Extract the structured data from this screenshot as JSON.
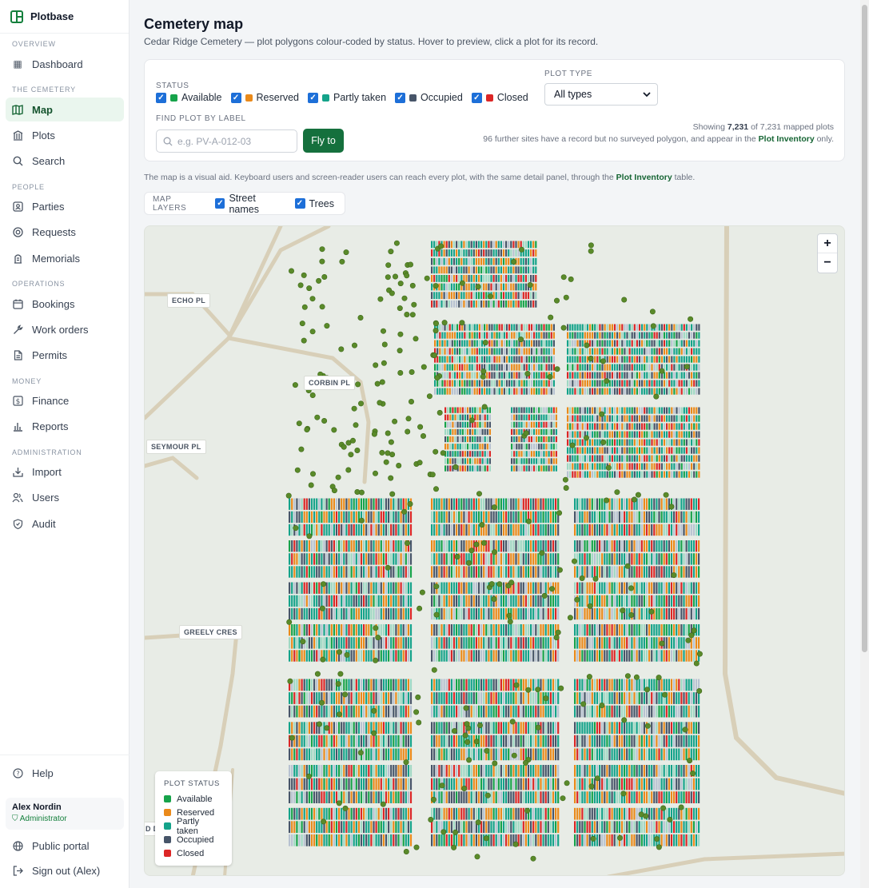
{
  "app": {
    "name": "Plotbase"
  },
  "sidebar": {
    "sections": {
      "overview": "OVERVIEW",
      "cemetery": "THE CEMETERY",
      "people": "PEOPLE",
      "operations": "OPERATIONS",
      "money": "MONEY",
      "administration": "ADMINISTRATION"
    },
    "items": {
      "dashboard": "Dashboard",
      "map": "Map",
      "plots": "Plots",
      "search": "Search",
      "parties": "Parties",
      "requests": "Requests",
      "memorials": "Memorials",
      "bookings": "Bookings",
      "work_orders": "Work orders",
      "permits": "Permits",
      "finance": "Finance",
      "reports": "Reports",
      "import": "Import",
      "users": "Users",
      "audit": "Audit",
      "help": "Help",
      "public_portal": "Public portal",
      "sign_out": "Sign out (Alex)"
    },
    "user": {
      "name": "Alex Nordin",
      "role": "Administrator"
    }
  },
  "page": {
    "title": "Cemetery map",
    "subtitle": "Cedar Ridge Cemetery — plot polygons colour-coded by status. Hover to preview, click a plot for its record."
  },
  "filters": {
    "status_label": "STATUS",
    "statuses": [
      {
        "label": "Available",
        "color": "#16a34a",
        "checked": true
      },
      {
        "label": "Reserved",
        "color": "#ea8a1a",
        "checked": true
      },
      {
        "label": "Partly taken",
        "color": "#14a38a",
        "checked": true
      },
      {
        "label": "Occupied",
        "color": "#475569",
        "checked": true
      },
      {
        "label": "Closed",
        "color": "#dc2626",
        "checked": true
      }
    ],
    "plot_type_label": "PLOT TYPE",
    "plot_type_value": "All types",
    "find_label": "FIND PLOT BY LABEL",
    "find_placeholder": "e.g. PV-A-012-03",
    "fly_button": "Fly to",
    "showing_prefix": "Showing",
    "showing_count": "7,231",
    "showing_suffix": "of 7,231 mapped plots",
    "further_text": "96 further sites have a record but no surveyed polygon, and appear in the",
    "further_link": "Plot Inventory",
    "further_end": "only."
  },
  "note": {
    "text": "The map is a visual aid. Keyboard users and screen-reader users can reach every plot, with the same detail panel, through the",
    "link": "Plot Inventory",
    "end": "table."
  },
  "layers": {
    "label": "MAP LAYERS",
    "street_names": "Street names",
    "trees": "Trees"
  },
  "map": {
    "streets": {
      "echo": "ECHO PL",
      "corbin": "CORBIN PL",
      "seymour": "SEYMOUR PL",
      "greely": "GREELY CRES",
      "partial": "D D"
    },
    "zoom_in": "+",
    "zoom_out": "−",
    "colors": {
      "available": "#16a34a",
      "reserved": "#ea8a1a",
      "partly": "#14a38a",
      "occupied": "#475569",
      "closed": "#dc2626",
      "tree": "#5a8a2a",
      "road": "#d8cfb8",
      "ground": "#e8ece6"
    }
  },
  "legend": {
    "title": "PLOT STATUS",
    "items": [
      {
        "label": "Available",
        "color": "#16a34a"
      },
      {
        "label": "Reserved",
        "color": "#ea8a1a"
      },
      {
        "label": "Partly taken",
        "color": "#14a38a"
      },
      {
        "label": "Occupied",
        "color": "#475569"
      },
      {
        "label": "Closed",
        "color": "#dc2626"
      }
    ]
  }
}
